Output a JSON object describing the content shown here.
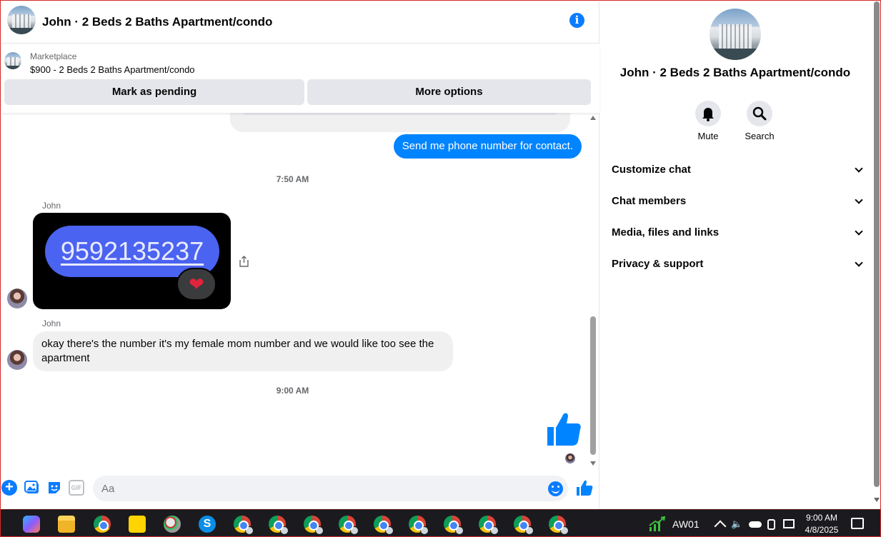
{
  "header": {
    "title": "John · 2 Beds 2 Baths Apartment/condo",
    "info_icon": "i"
  },
  "marketplace": {
    "label": "Marketplace",
    "listing": "$900 - 2 Beds 2 Baths Apartment/condo",
    "buttons": [
      "Mark as pending",
      "More options"
    ]
  },
  "messages": {
    "outgoing_1": "Send me phone number for contact.",
    "timestamp_1": "7:50 AM",
    "sender_1": "John",
    "phone_image_text": "9592135237",
    "reaction": "❤",
    "sender_2": "John",
    "incoming_2": "okay there's the number it's my female mom number and we would like too see the apartment",
    "timestamp_2": "9:00 AM"
  },
  "composer": {
    "placeholder": "Aa",
    "plus": "+",
    "gif": "GIF"
  },
  "info_panel": {
    "title": "John · 2 Beds 2 Baths Apartment/condo",
    "actions": [
      "Mute",
      "Search"
    ],
    "sections": [
      "Customize chat",
      "Chat members",
      "Media, files and links",
      "Privacy & support"
    ]
  },
  "taskbar": {
    "skype_letter": "S",
    "aw_label": "AW01",
    "clock_time": "9:00 AM",
    "clock_date": "4/8/2025",
    "sound_icon": "🔈"
  },
  "colors": {
    "messenger_blue": "#0084ff",
    "bubble_gray": "#f0f0f0",
    "button_gray": "#e4e6eb",
    "phone_pill": "#4b63f1",
    "taskbar": "#1b1b1f"
  },
  "icons": [
    "info-icon",
    "plus-icon",
    "photo-icon",
    "sticker-icon",
    "gif-icon",
    "emoji-icon",
    "like-icon",
    "share-icon",
    "bell-icon",
    "search-icon",
    "chevron-down-icon"
  ]
}
